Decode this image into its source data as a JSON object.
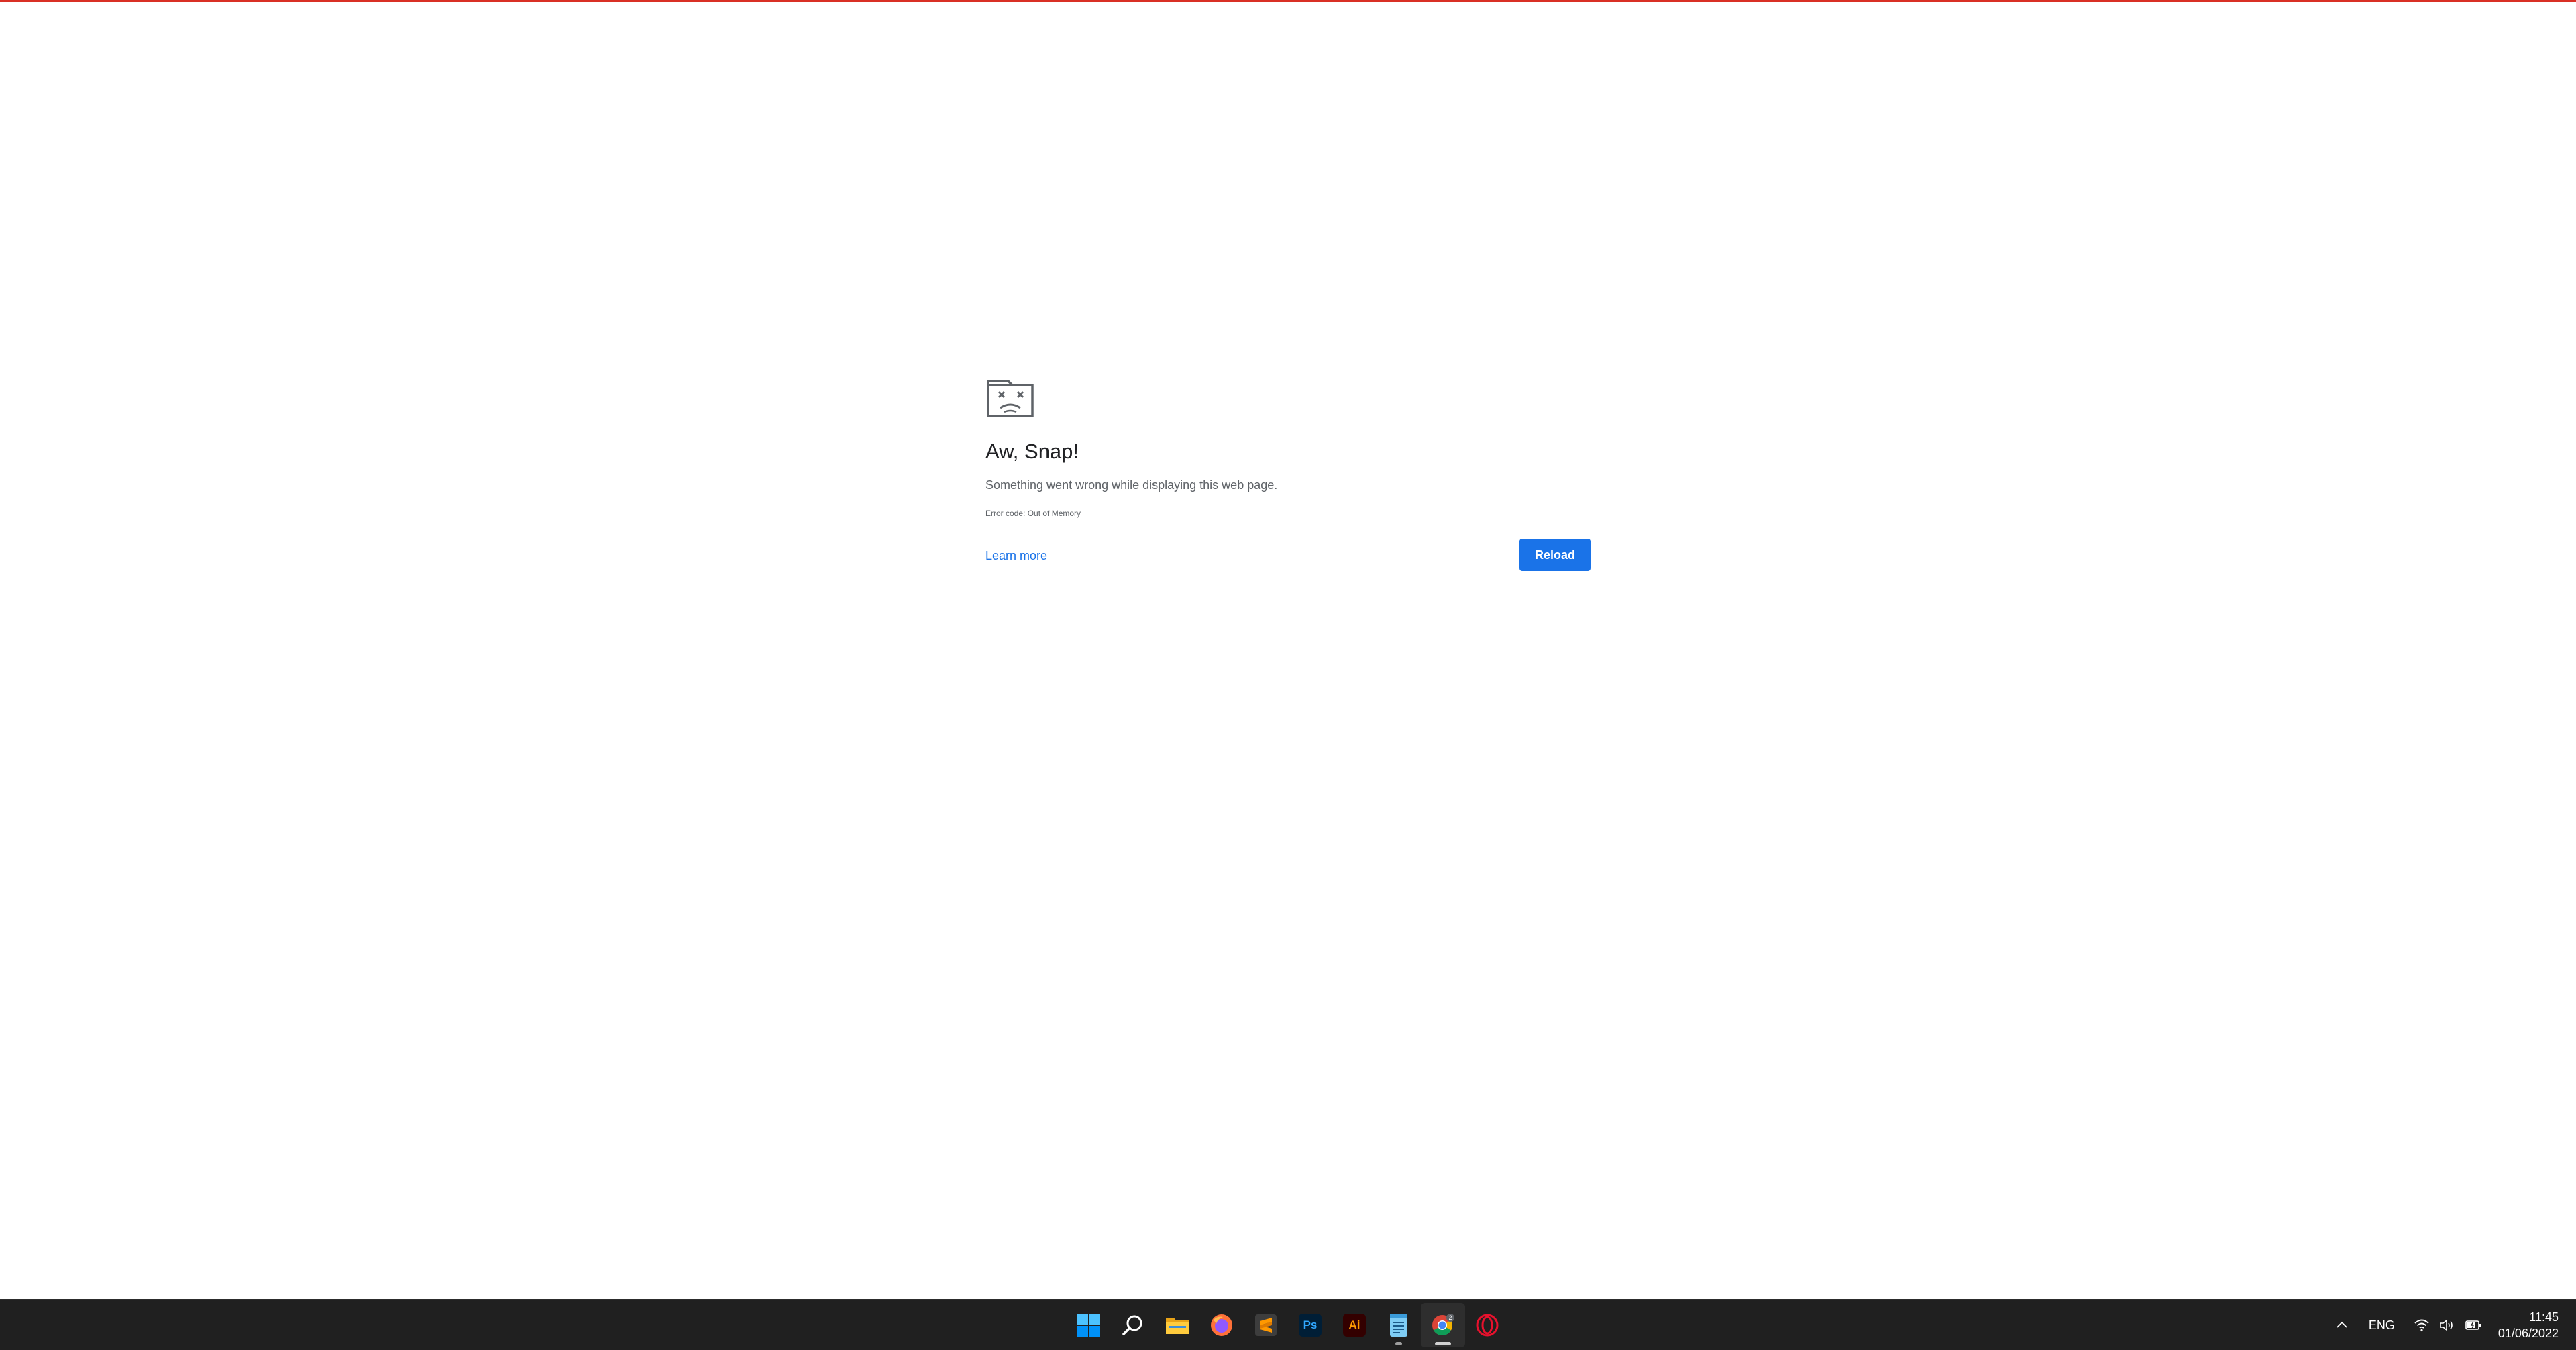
{
  "error_page": {
    "heading": "Aw, Snap!",
    "message": "Something went wrong while displaying this web page.",
    "error_code": "Error code: Out of Memory",
    "learn_more_label": "Learn more",
    "reload_label": "Reload",
    "icon": "sad-tab-icon"
  },
  "colors": {
    "accent": "#1a73e8",
    "top_line": "#d93025",
    "taskbar_bg": "#202020"
  },
  "taskbar": {
    "apps": [
      {
        "name": "Start",
        "icon": "windows-start-icon"
      },
      {
        "name": "Search",
        "icon": "search-icon"
      },
      {
        "name": "File Explorer",
        "icon": "folder-icon"
      },
      {
        "name": "Firefox",
        "icon": "firefox-icon"
      },
      {
        "name": "Sublime Text",
        "icon": "sublime-text-icon"
      },
      {
        "name": "Photoshop",
        "icon": "photoshop-icon",
        "label": "Ps"
      },
      {
        "name": "Illustrator",
        "icon": "illustrator-icon",
        "label": "Ai"
      },
      {
        "name": "Notepad",
        "icon": "notepad-icon"
      },
      {
        "name": "Chrome",
        "icon": "chrome-icon",
        "badge": "2"
      },
      {
        "name": "Opera",
        "icon": "opera-icon"
      }
    ],
    "tray": {
      "overflow_icon": "chevron-up-icon",
      "language": "ENG",
      "status_icons": [
        "wifi-icon",
        "volume-icon",
        "battery-icon"
      ],
      "time": "11:45",
      "date": "01/06/2022"
    }
  }
}
